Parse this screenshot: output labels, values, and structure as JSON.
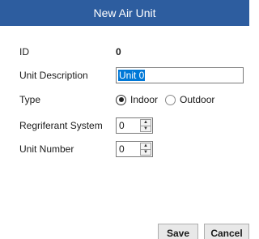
{
  "dialog": {
    "title": "New Air Unit"
  },
  "fields": {
    "id": {
      "label": "ID",
      "value": "0"
    },
    "description": {
      "label": "Unit Description",
      "value": "Unit 0"
    },
    "type": {
      "label": "Type",
      "options": [
        "Indoor",
        "Outdoor"
      ],
      "selected": "Indoor"
    },
    "refrigerant_system": {
      "label": "Regriferant System",
      "value": "0"
    },
    "unit_number": {
      "label": "Unit Number",
      "value": "0"
    }
  },
  "buttons": {
    "save": "Save",
    "cancel": "Cancel"
  },
  "colors": {
    "title_bar": "#2d5d9f",
    "selection": "#0078d7"
  }
}
